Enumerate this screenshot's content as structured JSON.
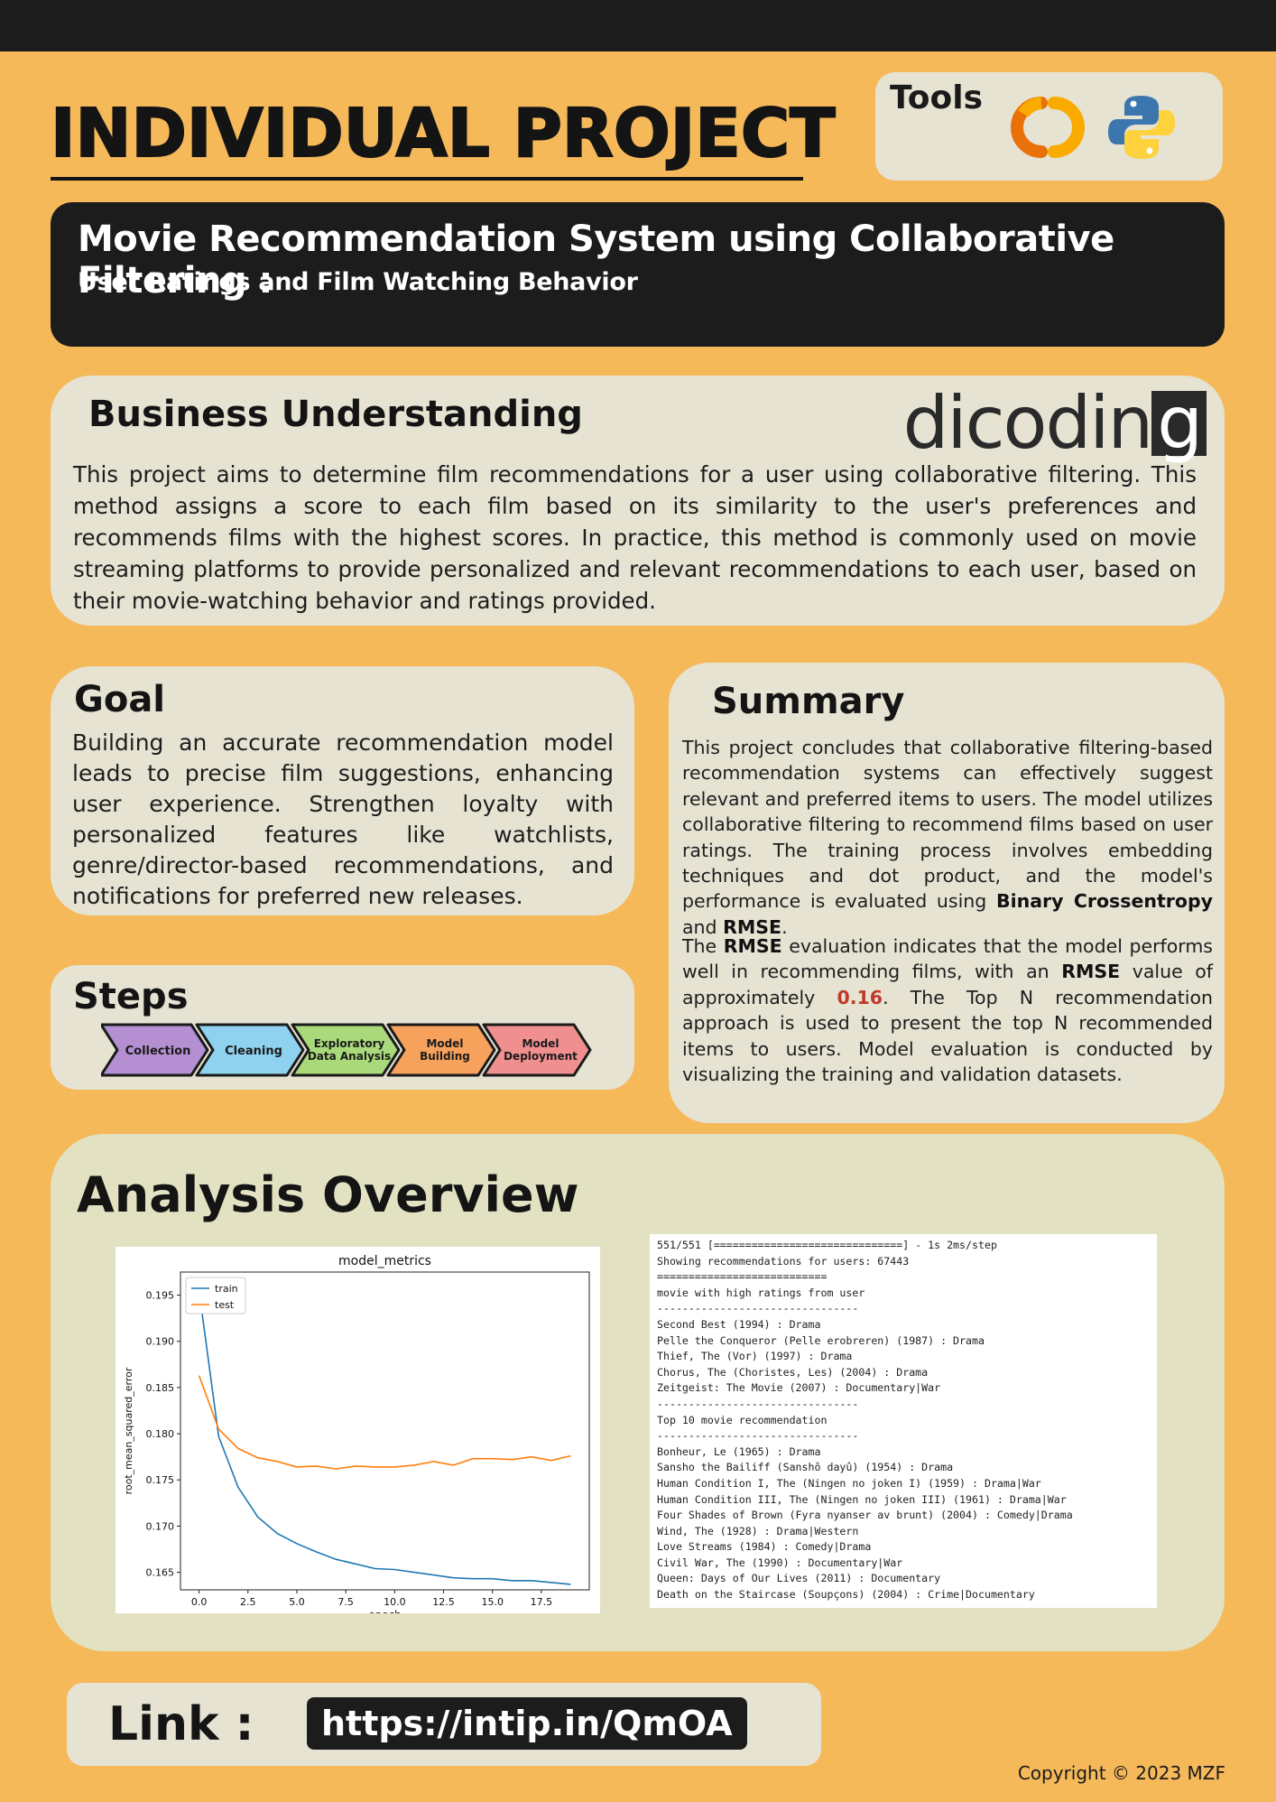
{
  "page": {
    "title": "INDIVIDUAL PROJECT",
    "tools_label": "Tools",
    "tool_icons": [
      "colab-icon",
      "python-icon"
    ]
  },
  "banner": {
    "title": "Movie Recommendation System using Collaborative Filtering :",
    "subtitle": "User Ratings and Film Watching Behavior"
  },
  "business": {
    "heading": "Business Understanding",
    "logo_text": "dicodin",
    "logo_last": "g",
    "text": "This project aims to determine film recommendations for a user using collaborative filtering. This method assigns a score to each film based on its similarity to the user's preferences and recommends films with the highest scores. In practice, this method is commonly used on movie streaming platforms to provide personalized and relevant recommendations to each user, based on their movie-watching behavior and ratings provided."
  },
  "goal": {
    "heading": "Goal",
    "text": "Building an accurate recommendation model leads to precise film suggestions, enhancing user experience. Strengthen loyalty with personalized features like watchlists, genre/director-based recommendations, and notifications for preferred new releases."
  },
  "steps": {
    "heading": "Steps",
    "items": [
      {
        "label": "Collection",
        "color": "#b48fd1"
      },
      {
        "label": "Cleaning",
        "color": "#8fd2ef"
      },
      {
        "label": "Exploratory Data Analysis",
        "color": "#a9d97a"
      },
      {
        "label": "Model Building",
        "color": "#f6a25c"
      },
      {
        "label": "Model Deployment",
        "color": "#f08f8f"
      }
    ]
  },
  "summary": {
    "heading": "Summary",
    "p1_text": "This project concludes that collaborative filtering-based recommendation systems can effectively suggest relevant and preferred items to users. The model utilizes collaborative filtering to recommend films based on user ratings. The training process involves embedding techniques and dot product, and the model's performance is evaluated using ",
    "p1_b1": "Binary Crossentropy",
    "p1_and": " and ",
    "p1_b2": "RMSE",
    "p1_end": ".",
    "p2_a": "The ",
    "p2_b1": "RMSE",
    "p2_b": " evaluation indicates that the model performs well in recommending films, with an ",
    "p2_b2": "RMSE",
    "p2_c": " value of approximately ",
    "p2_value": "0.16",
    "p2_d": ". The Top N recommendation approach is used to present the top N recommended items to users. Model evaluation is conducted by visualizing the training and validation datasets."
  },
  "analysis": {
    "heading": "Analysis Overview",
    "console_lines": [
      "551/551 [==============================] - 1s 2ms/step",
      "Showing recommendations for users: 67443",
      "===========================",
      "movie with high ratings from user",
      "--------------------------------",
      "Second Best (1994) : Drama",
      "Pelle the Conqueror (Pelle erobreren) (1987) : Drama",
      "Thief, The (Vor) (1997) : Drama",
      "Chorus, The (Choristes, Les) (2004) : Drama",
      "Zeitgeist: The Movie (2007) : Documentary|War",
      "--------------------------------",
      "Top 10 movie recommendation",
      "--------------------------------",
      "Bonheur, Le (1965) : Drama",
      "Sansho the Bailiff (Sanshô dayû) (1954) : Drama",
      "Human Condition I, The (Ningen no joken I) (1959) : Drama|War",
      "Human Condition III, The (Ningen no joken III) (1961) : Drama|War",
      "Four Shades of Brown (Fyra nyanser av brunt) (2004) : Comedy|Drama",
      "Wind, The (1928) : Drama|Western",
      "Love Streams (1984) : Comedy|Drama",
      "Civil War, The (1990) : Documentary|War",
      "Queen: Days of Our Lives (2011) : Documentary",
      "Death on the Staircase (Soupçons) (2004) : Crime|Documentary"
    ]
  },
  "chart_data": {
    "type": "line",
    "title": "model_metrics",
    "xlabel": "epoch",
    "ylabel": "root_mean_squared_error",
    "x": [
      0,
      1,
      2,
      3,
      4,
      5,
      6,
      7,
      8,
      9,
      10,
      11,
      12,
      13,
      14,
      15,
      16,
      17,
      18,
      19
    ],
    "series": [
      {
        "name": "train",
        "color": "#1f77b4",
        "values": [
          0.1955,
          0.1797,
          0.1742,
          0.171,
          0.1692,
          0.1681,
          0.1672,
          0.1664,
          0.1659,
          0.1654,
          0.1653,
          0.165,
          0.1647,
          0.1644,
          0.1643,
          0.1643,
          0.1641,
          0.1641,
          0.1639,
          0.1637
        ]
      },
      {
        "name": "test",
        "color": "#ff7f0e",
        "values": [
          0.1863,
          0.1805,
          0.1784,
          0.1774,
          0.177,
          0.1764,
          0.1765,
          0.1762,
          0.1765,
          0.1764,
          0.1764,
          0.1766,
          0.177,
          0.1766,
          0.1773,
          0.1773,
          0.1772,
          0.1775,
          0.1771,
          0.1776
        ]
      }
    ],
    "xticks": [
      0.0,
      2.5,
      5.0,
      7.5,
      10.0,
      12.5,
      15.0,
      17.5
    ],
    "xtick_labels": [
      "0.0",
      "2.5",
      "5.0",
      "7.5",
      "10.0",
      "12.5",
      "15.0",
      "17.5"
    ],
    "yticks": [
      0.165,
      0.17,
      0.175,
      0.18,
      0.185,
      0.19,
      0.195
    ],
    "ytick_labels": [
      "0.165",
      "0.170",
      "0.175",
      "0.180",
      "0.185",
      "0.190",
      "0.195"
    ],
    "xlim": [
      -0.95,
      19.95
    ],
    "ylim": [
      0.1631,
      0.1975
    ],
    "legend": "upper-left",
    "grid": false
  },
  "link": {
    "label": "Link :",
    "url": "https://intip.in/QmOA"
  },
  "footer": {
    "copyright": "Copyright © 2023 MZF"
  }
}
